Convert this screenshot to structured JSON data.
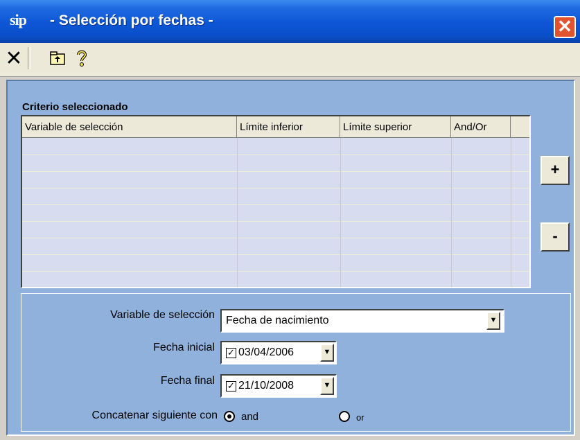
{
  "window": {
    "app_icon_text": "sip",
    "title": "- Selección por fechas -",
    "close_glyph": "✕"
  },
  "toolbar": {
    "close_glyph": "✕",
    "up_folder_icon": "up-folder-icon",
    "help_icon": "question-icon"
  },
  "criteria": {
    "label": "Criterio seleccionado",
    "columns": [
      "Variable de selección",
      "Límite inferior",
      "Límite superior",
      "And/Or",
      ""
    ],
    "rows": []
  },
  "buttons": {
    "add_label": "+",
    "remove_label": "-"
  },
  "form": {
    "variable_label": "Variable de selección",
    "variable_value": "Fecha de nacimiento",
    "start_label": "Fecha inicial",
    "start_checked": true,
    "start_value": "03/04/2006",
    "end_label": "Fecha final",
    "end_checked": true,
    "end_value": "21/10/2008",
    "concat_label": "Concatenar siguiente con",
    "concat_options": [
      "and",
      "or"
    ],
    "concat_selected": "and"
  },
  "colors": {
    "titlebar": "#0c56d6",
    "panel": "#8fb1dc",
    "grid_bg": "#d8dcf0",
    "close_button": "#e2542f"
  }
}
